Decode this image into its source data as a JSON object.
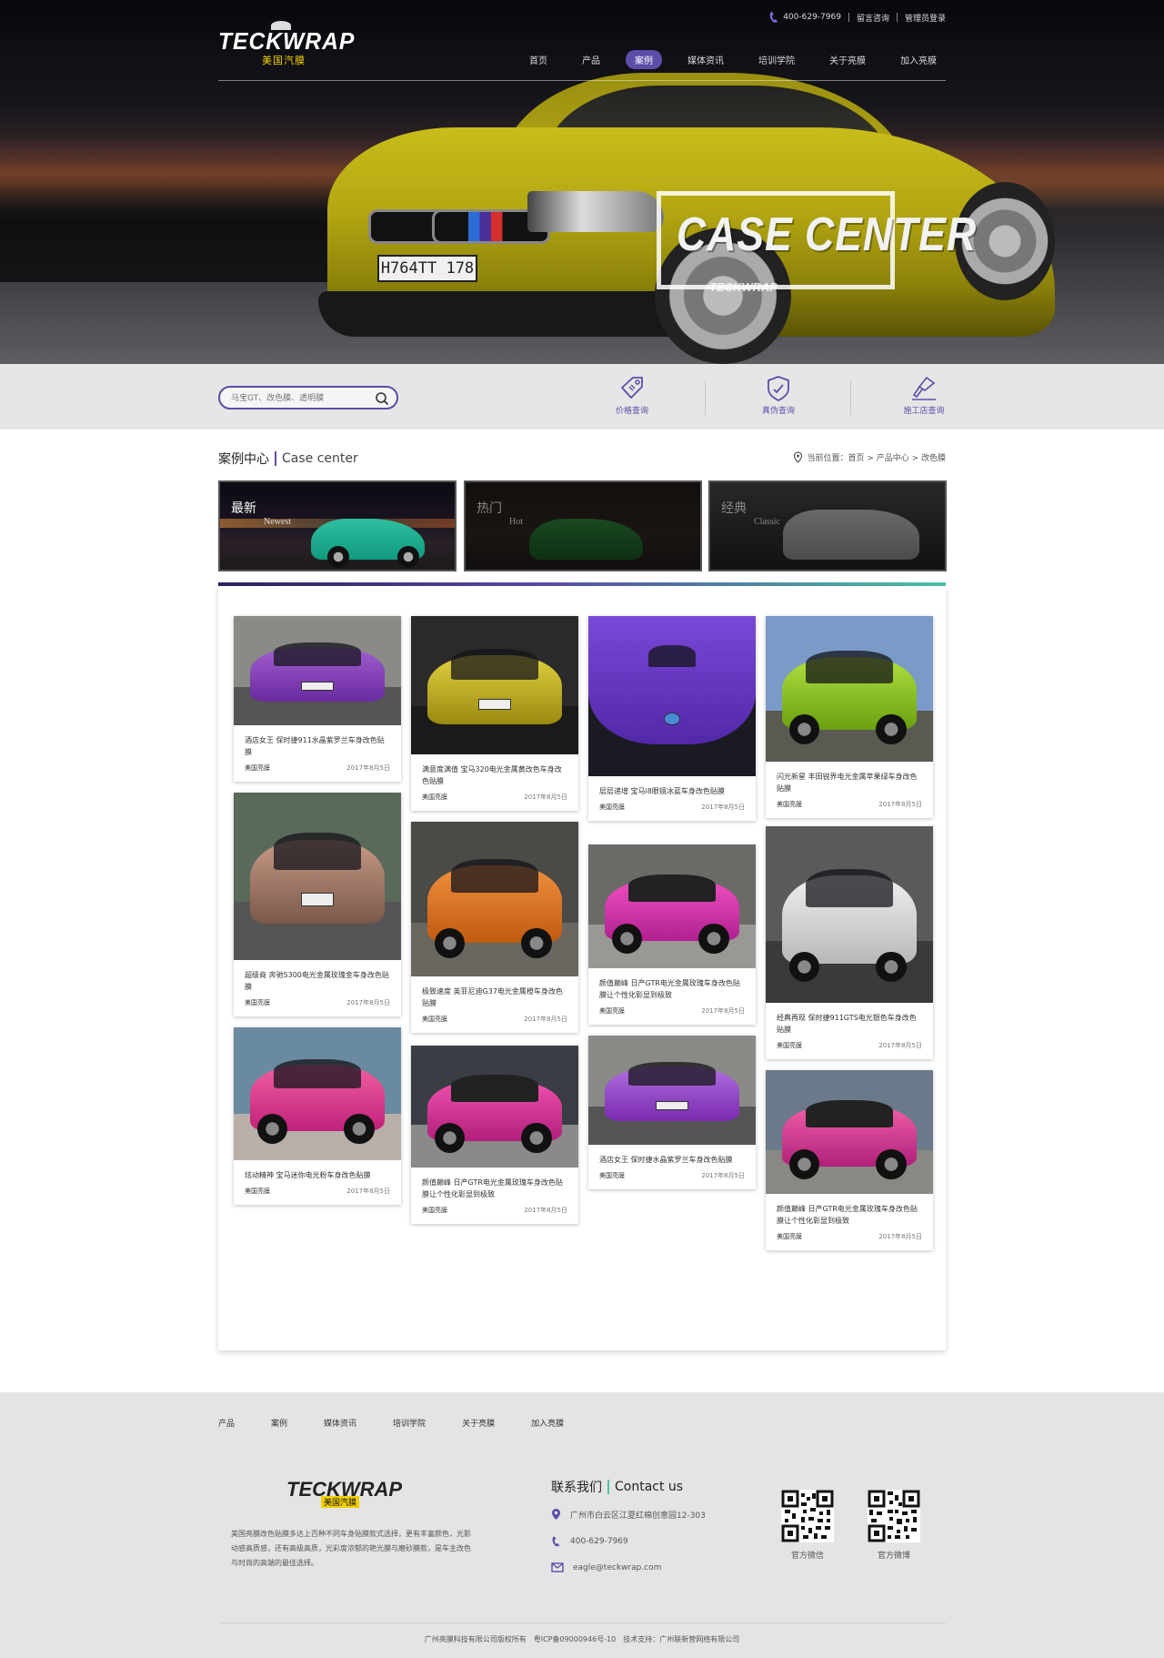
{
  "header": {
    "logo_text": "TECKWRAP",
    "logo_sub": "美国汽膜",
    "phone": "400-629-7969",
    "top_links": [
      "留言咨询",
      "管理员登录"
    ],
    "nav": [
      {
        "label": "首页",
        "active": false
      },
      {
        "label": "产品",
        "active": false
      },
      {
        "label": "案例",
        "active": true
      },
      {
        "label": "媒体资讯",
        "active": false
      },
      {
        "label": "培训学院",
        "active": false
      },
      {
        "label": "关于亮膜",
        "active": false
      },
      {
        "label": "加入亮膜",
        "active": false
      }
    ]
  },
  "hero": {
    "title": "CASE CENTER",
    "sub": "TECKWRAP",
    "plate": "H764TT 178"
  },
  "search": {
    "placeholder": "马宝GT、改色膜、透明膜"
  },
  "quick_links": [
    {
      "label": "价格查询",
      "icon": "price-tag-icon"
    },
    {
      "label": "真伪查询",
      "icon": "shield-icon"
    },
    {
      "label": "施工店查询",
      "icon": "spray-gun-icon"
    }
  ],
  "section": {
    "title_cn": "案例中心",
    "title_en": "Case center",
    "breadcrumb": "当前位置：首页 > 产品中心 > 改色膜"
  },
  "categories": [
    {
      "cn": "最新",
      "en": "Newest",
      "active": true
    },
    {
      "cn": "热门",
      "en": "Hot",
      "active": false
    },
    {
      "cn": "经典",
      "en": "Classic",
      "active": false
    }
  ],
  "cards": [
    {
      "title": "酒店女王 保时捷911水晶紫罗兰车身改色贴膜",
      "author": "美国亮膜",
      "date": "2017年8月5日",
      "color": "#7a3aa8"
    },
    {
      "title": "满意度满值 宝马320电光金属黄改色车身改色贴膜",
      "author": "美国亮膜",
      "date": "2017年8月5日",
      "color": "#c2b41a"
    },
    {
      "title": "层层递增 宝马i8眼镜冰蓝车身改色贴膜",
      "author": "美国亮膜",
      "date": "2017年8月5日",
      "color": "#6a38c8"
    },
    {
      "title": "闪光新星 丰田锐界电光金属苹果绿车身改色贴膜",
      "author": "美国亮膜",
      "date": "2017年8月5日",
      "color": "#9ad21a"
    },
    {
      "title": "超级商 奔驰S300电光金属玫瑰金车身改色贴膜",
      "author": "美国亮膜",
      "date": "2017年8月5日",
      "color": "#a87868"
    },
    {
      "title": "极致速度 英菲尼迪G37电光金属橙车身改色贴膜",
      "author": "美国亮膜",
      "date": "2017年8月5日",
      "color": "#e0741e"
    },
    {
      "title": "颜值巅峰 日产GTR电光金属玫瑰车身改色贴膜让个性化彰显到极致",
      "author": "美国亮膜",
      "date": "2017年8月5日",
      "color": "#d42a9a"
    },
    {
      "title": "经典再现 保时捷911GTS电光银色车身改色贴膜",
      "author": "美国亮膜",
      "date": "2017年8月5日",
      "color": "#c8c8c8"
    },
    {
      "title": "炫动精神 宝马迷你电光粉车身改色贴膜",
      "author": "美国亮膜",
      "date": "2017年8月5日",
      "color": "#e03a8a"
    },
    {
      "title": "颜值巅峰 日产GTR电光金属玫瑰车身改色贴膜让个性化彰显到极致",
      "author": "美国亮膜",
      "date": "2017年8月5日",
      "color": "#d42a8a"
    },
    {
      "title": "酒店女王 保时捷水晶紫罗兰车身改色贴膜",
      "author": "美国亮膜",
      "date": "2017年8月5日",
      "color": "#8a3ab8"
    },
    {
      "title": "颜值巅峰 日产GTR电光金属玫瑰车身改色贴膜让个性化彰显到极致",
      "author": "美国亮膜",
      "date": "2017年8月5日",
      "color": "#d43a8a"
    }
  ],
  "footer": {
    "nav": [
      "产品",
      "案例",
      "媒体资讯",
      "培训学院",
      "关于亮膜",
      "加入亮膜"
    ],
    "logo_text": "TECKWRAP",
    "logo_sub": "美国汽膜",
    "description": "美国亮膜改色贴膜多达上百种不同车身贴膜款式选择，更有丰富颜色，光影动感高质感，还有高级高质，光彩度浓郁的艳光膜与磨砂膜款，是车主改色与时尚的高端的最佳选择。",
    "contact_title_cn": "联系我们",
    "contact_title_en": "Contact us",
    "address": "广州市白云区江夏红棉创意园12-303",
    "phone": "400-629-7969",
    "email": "eagle@teckwrap.com",
    "qr_labels": [
      "官方微信",
      "官方微博"
    ],
    "copyright": "广州亮膜科技有限公司版权所有　粤ICP备09000946号-10　技术支持：广州联新营网络有限公司"
  }
}
